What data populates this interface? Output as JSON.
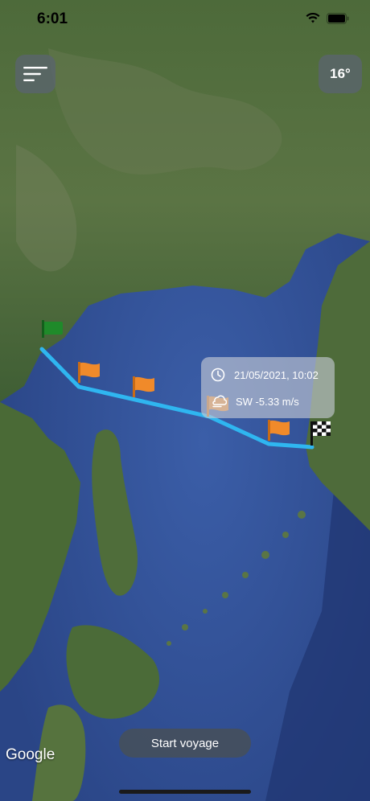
{
  "status_bar": {
    "time": "6:01"
  },
  "controls": {
    "temperature": "16°"
  },
  "voyage": {
    "route_color": "#2fb6f0",
    "checkpoint_color": "#f08a2a",
    "start_flag_color": "#1f8a2a"
  },
  "weather_popup": {
    "datetime": "21/05/2021, 10:02",
    "wind": "SW -5.33 m/s"
  },
  "actions": {
    "start_label": "Start voyage"
  },
  "map": {
    "attribution": "Google"
  }
}
